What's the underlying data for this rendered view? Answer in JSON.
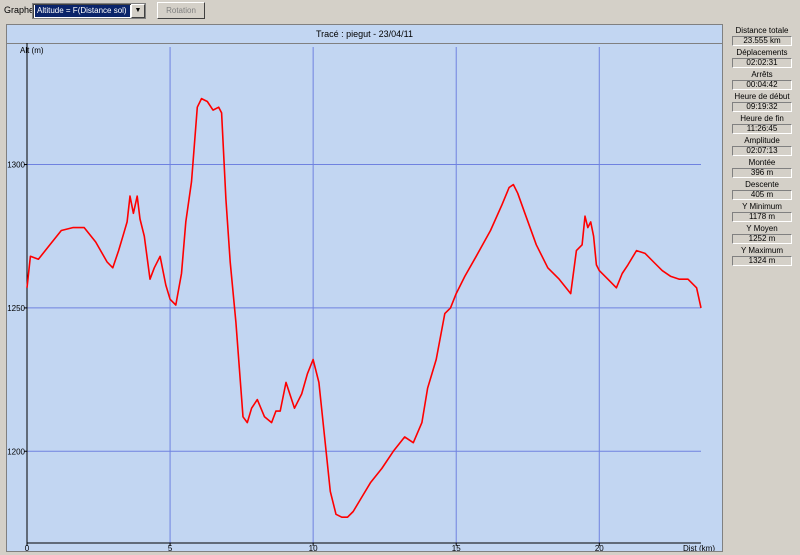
{
  "toolbar": {
    "graph_label": "Graphe",
    "graph_select_value": "Altitude = F(Distance sol)",
    "rotation_label": "Rotation"
  },
  "chart_data": {
    "type": "line",
    "title": "Tracé : piegut - 23/04/11",
    "xlabel": "Dist (km)",
    "ylabel": "Alt (m)",
    "xlim": [
      0,
      23.555
    ],
    "ylim": [
      1168,
      1341
    ],
    "xticks": [
      0,
      5,
      10,
      15,
      20
    ],
    "yticks": [
      1200,
      1250,
      1300
    ],
    "grid": true,
    "line_color": "#ff0000",
    "grid_color": "#6f82e0",
    "series": [
      {
        "x": [
          0,
          0.12,
          0.4,
          0.8,
          1.2,
          1.6,
          2.0,
          2.4,
          2.8,
          3.0,
          3.2,
          3.35,
          3.5,
          3.6,
          3.72,
          3.85,
          3.95,
          4.1,
          4.3,
          4.45,
          4.65,
          4.85,
          5.0,
          5.2,
          5.4,
          5.55,
          5.75,
          5.95,
          6.1,
          6.3,
          6.5,
          6.7,
          6.8,
          6.95,
          7.1,
          7.3,
          7.55,
          7.7,
          7.85,
          8.05,
          8.3,
          8.55,
          8.7,
          8.85,
          9.05,
          9.35,
          9.6,
          9.8,
          10.0,
          10.2,
          10.4,
          10.6,
          10.8,
          11.0,
          11.2,
          11.4,
          11.7,
          12.0,
          12.4,
          12.8,
          13.2,
          13.5,
          13.8,
          14.0,
          14.3,
          14.6,
          14.8,
          15.0,
          15.3,
          15.7,
          16.2,
          16.6,
          16.85,
          17.0,
          17.15,
          17.4,
          17.8,
          18.2,
          18.6,
          19.0,
          19.2,
          19.4,
          19.5,
          19.6,
          19.7,
          19.8,
          19.9,
          20.0,
          20.3,
          20.6,
          20.8,
          21.0,
          21.3,
          21.6,
          21.9,
          22.2,
          22.5,
          22.8,
          23.1,
          23.4,
          23.555
        ],
        "y": [
          1257,
          1268,
          1267,
          1272,
          1277,
          1278,
          1278,
          1273,
          1266,
          1264,
          1270,
          1275,
          1280,
          1289,
          1283,
          1289,
          1281,
          1275,
          1260,
          1264,
          1268,
          1258,
          1253,
          1251,
          1262,
          1280,
          1294,
          1320,
          1323,
          1322,
          1319,
          1320,
          1318,
          1288,
          1266,
          1245,
          1212,
          1210,
          1215,
          1218,
          1212,
          1210,
          1214,
          1214,
          1224,
          1215,
          1220,
          1227,
          1232,
          1224,
          1205,
          1186,
          1178,
          1177,
          1177,
          1179,
          1184,
          1189,
          1194,
          1200,
          1205,
          1203,
          1210,
          1222,
          1232,
          1248,
          1250,
          1255,
          1261,
          1268,
          1277,
          1286,
          1292,
          1293,
          1290,
          1283,
          1272,
          1264,
          1260,
          1255,
          1270,
          1272,
          1282,
          1278,
          1280,
          1275,
          1265,
          1263,
          1260,
          1257,
          1262,
          1265,
          1270,
          1269,
          1266,
          1263,
          1261,
          1260,
          1260,
          1257,
          1250
        ]
      }
    ]
  },
  "stats": [
    {
      "label": "Distance totale",
      "value": "23.555 km"
    },
    {
      "label": "Déplacements",
      "value": "02:02:31"
    },
    {
      "label": "Arrêts",
      "value": "00:04:42"
    },
    {
      "label": "Heure de début",
      "value": "09:19:32"
    },
    {
      "label": "Heure de fin",
      "value": "11:26:45"
    },
    {
      "label": "Amplitude",
      "value": "02:07:13"
    },
    {
      "label": "Montée",
      "value": "396 m"
    },
    {
      "label": "Descente",
      "value": "405 m"
    },
    {
      "label": "Y Minimum",
      "value": "1178 m"
    },
    {
      "label": "Y Moyen",
      "value": "1252 m"
    },
    {
      "label": "Y Maximum",
      "value": "1324 m"
    }
  ]
}
